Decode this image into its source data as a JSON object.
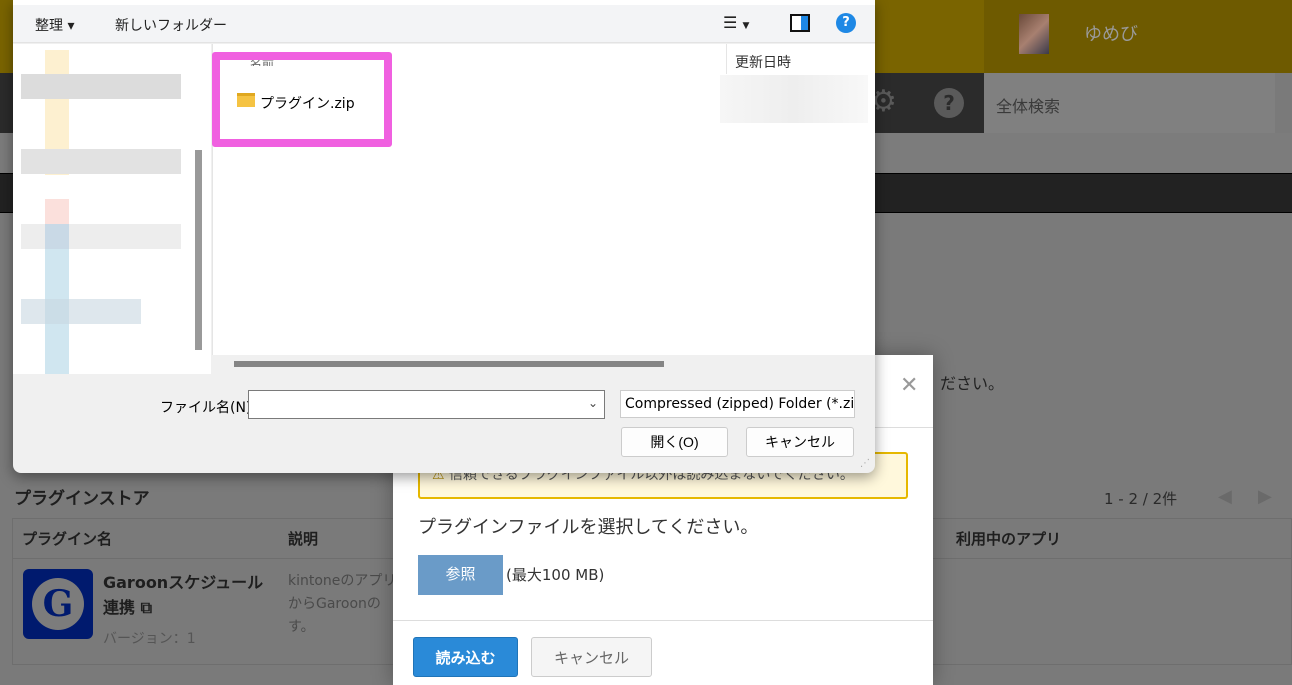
{
  "app_header": {
    "user_name": "ゆめび",
    "search_placeholder": "全体検索"
  },
  "background": {
    "partial_text": "ださい。",
    "section_title": "プラグインストア",
    "pagination": "1 - 2 / 2件",
    "table": {
      "headers": [
        "プラグイン名",
        "説明",
        "利用中のアプリ"
      ],
      "rows": [
        {
          "icon_letter": "G",
          "name": "Garoonスケジュール連携",
          "version": "バージョン：1",
          "description": "kintoneのアプリからGaroonのす。"
        }
      ]
    }
  },
  "modal": {
    "warning": "信頼できるプラグインファイル以外は読み込まないでください。",
    "instruction": "プラグインファイルを選択してください。",
    "browse_label": "参照",
    "max_size": "(最大100 MB)",
    "load_label": "読み込む",
    "cancel_label": "キャンセル"
  },
  "file_dialog": {
    "organize_label": "整理 ▾",
    "new_folder_label": "新しいフォルダー",
    "column_name": "名前",
    "column_modified": "更新日時",
    "files": [
      {
        "name": "プラグイン.zip"
      }
    ],
    "filename_label": "ファイル名(N):",
    "filename_value": "",
    "filetype_value": "Compressed (zipped) Folder (*.zip)",
    "open_label": "開く(O)",
    "cancel_label": "キャンセル"
  },
  "colors": {
    "highlight": "#f060e0",
    "primary": "#2a8ad8",
    "browse": "#6a9bc8"
  }
}
